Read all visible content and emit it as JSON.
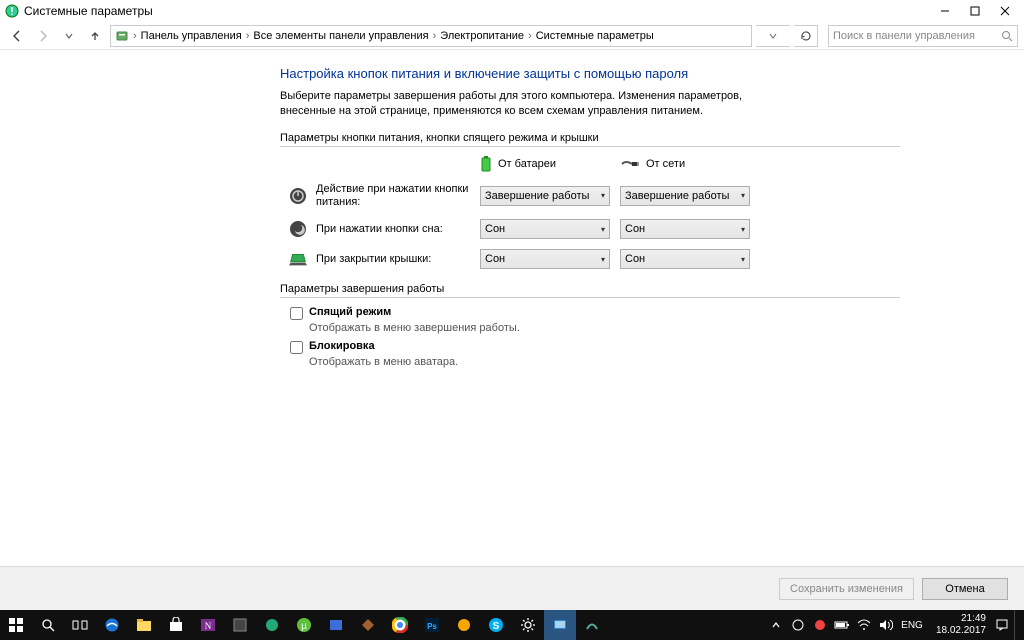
{
  "titlebar": {
    "title": "Системные параметры"
  },
  "breadcrumb": {
    "items": [
      "Панель управления",
      "Все элементы панели управления",
      "Электропитание",
      "Системные параметры"
    ]
  },
  "search": {
    "placeholder": "Поиск в панели управления"
  },
  "main": {
    "heading": "Настройка кнопок питания и включение защиты с помощью пароля",
    "desc": "Выберите параметры завершения работы для этого компьютера. Изменения параметров, внесенные на этой странице, применяются ко всем схемам управления питанием.",
    "group1_title": "Параметры кнопки питания, кнопки спящего режима и крышки",
    "col_battery": "От батареи",
    "col_ac": "От сети",
    "rows": [
      {
        "label": "Действие при нажатии кнопки питания:",
        "battery_val": "Завершение работы",
        "ac_val": "Завершение работы"
      },
      {
        "label": "При нажатии кнопки сна:",
        "battery_val": "Сон",
        "ac_val": "Сон"
      },
      {
        "label": "При закрытии крышки:",
        "battery_val": "Сон",
        "ac_val": "Сон"
      }
    ],
    "group2_title": "Параметры завершения работы",
    "checks": [
      {
        "label": "Спящий режим",
        "sub": "Отображать в меню завершения работы."
      },
      {
        "label": "Блокировка",
        "sub": "Отображать в меню аватара."
      }
    ]
  },
  "footer": {
    "save": "Сохранить изменения",
    "cancel": "Отмена"
  },
  "taskbar": {
    "lang": "ENG",
    "time": "21:49",
    "date": "18.02.2017"
  }
}
